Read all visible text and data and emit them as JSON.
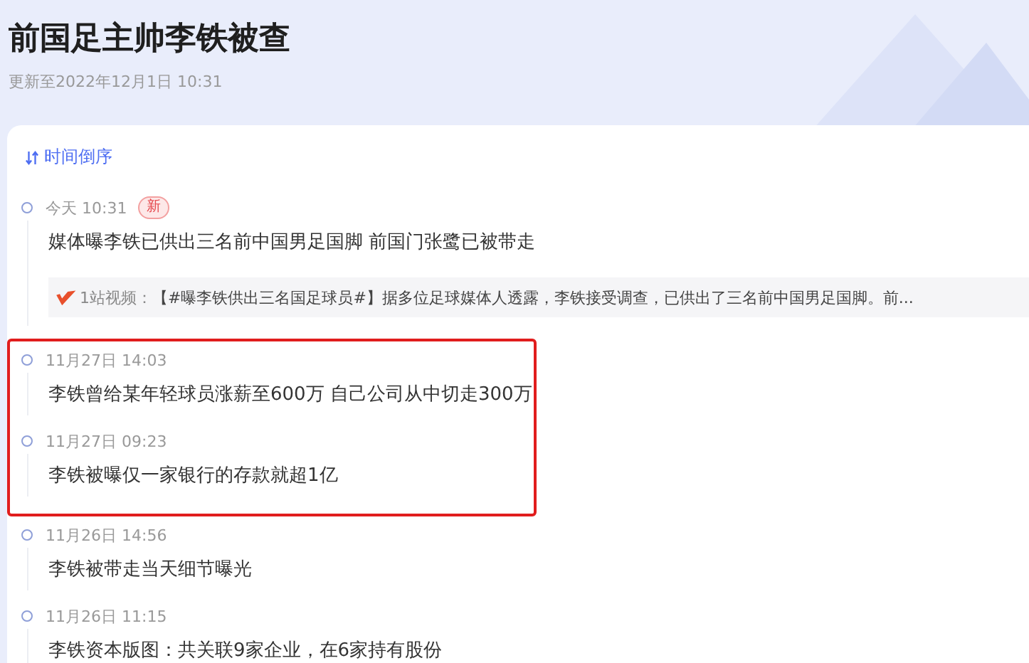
{
  "title": "前国足主帅李铁被查",
  "updated": "更新至2022年12月1日 10:31",
  "sort_label": "时间倒序",
  "entries": [
    {
      "time": "今天 10:31",
      "badge": "新",
      "text": "媒体曝李铁已供出三名前中国男足国脚 前国门张鹭已被带走",
      "highlighted": false,
      "video": {
        "source": "1站视频：",
        "text": "【#曝李铁供出三名国足球员#】据多位足球媒体人透露，李铁接受调查，已供出了三名前中国男足国脚。前..."
      }
    },
    {
      "time": "11月27日 14:03",
      "text": "李铁曾给某年轻球员涨薪至600万 自己公司从中切走300万",
      "highlighted": true
    },
    {
      "time": "11月27日 09:23",
      "text": "李铁被曝仅一家银行的存款就超1亿",
      "highlighted": true
    },
    {
      "time": "11月26日 14:56",
      "text": "李铁被带走当天细节曝光",
      "highlighted": false
    },
    {
      "time": "11月26日 11:15",
      "text": "李铁资本版图：共关联9家企业，在6家持有股份",
      "highlighted": false
    }
  ]
}
